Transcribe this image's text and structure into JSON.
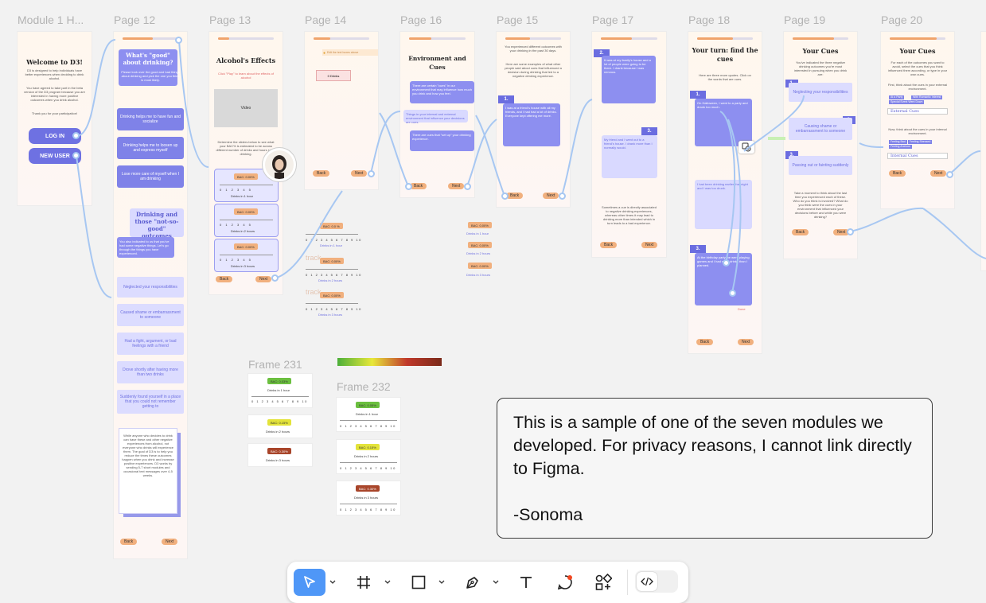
{
  "labels": {
    "module": "Module 1 H...",
    "p12": "Page 12",
    "p13": "Page 13",
    "p14": "Page 14",
    "p16": "Page 16",
    "p15": "Page 15",
    "p17": "Page 17",
    "p18": "Page 18",
    "p19": "Page 19",
    "p20": "Page 20",
    "f231": "Frame 231",
    "f232": "Frame 232"
  },
  "m1": {
    "title": "Welcome to D3!",
    "intro": "D3 is designed to help individuals have better experiences when deciding to drink alcohol.",
    "body": "You have agreed to take part in the beta version of the D3 program because you are interested in having more positive outcomes when you drink alcohol.",
    "thanks": "Thank you for your participation!",
    "login": "LOG IN",
    "newuser": "NEW USER"
  },
  "p12": {
    "q1": "What's \"good\" about drinking?",
    "q1_sub": "Please look over the good and bad things about drinking and pick the one you think is most likely.",
    "opt1": "Drinking helps me to have fun and socialize",
    "opt2": "Drinking helps me to loosen up and express myself",
    "opt3": "Lose more care of myself when I am drinking",
    "q2": "Drinking and those \"not-so-good\" outcomes",
    "q2_sub": "You also indicated to us that you've had some negative things. Let's go through the things you have experienced.",
    "neg1": "Neglected your responsibilities",
    "neg2": "Caused shame or embarrassment to someone",
    "neg3": "Had a fight, argument, or bad feelings with a friend",
    "neg4": "Drove shortly after having more than two drinks",
    "neg5": "Suddenly found yourself in a place that you could not remember getting to",
    "card": "While anyone who decides to drink can have these and other negative experiences from alcohol, not everyone who drinks will experience them. The goal of D3 is to help you reduce the times these outcomes happen when you drink and increase positive experiences. D3 works by sending 5-7 short modules and occasional text messages over 4-5 weeks.",
    "back": "Back",
    "next": "Next"
  },
  "p13": {
    "title": "Alcohol's Effects",
    "sub": "Click \"Play\" to learn about the effects of alcohol",
    "video": "Video",
    "body": "Determine the sliders below to see what your BAC% is estimated to be across different number of drinks and hours spent drinking.",
    "bac": "BAC: 0.00%",
    "scale": "0 1 2 3 4 5",
    "d1": "Drinks in 1 hour",
    "d2": "Drinks in 2 hours",
    "d3": "Drinks in 3 hours",
    "back": "Back",
    "next": "Next"
  },
  "p14": {
    "note": "Edit the text boxes above",
    "box": "0 Drinks",
    "back": "Back",
    "next": "Next",
    "bac1": "BAC: 0.0 %",
    "bac2": "BAC: 0.00%",
    "bac3": "BAC: 0.00%",
    "scale": "0 1 2 3 4 5 6 7 8 9 10",
    "d1": "Drinks in 1 hour",
    "d2": "Drinks in 2 hours",
    "d3": "Drinks in 3 hours",
    "track": "track"
  },
  "p16": {
    "title": "Environment and Cues",
    "b1": "There are certain \"cues\" in our environment that may influence how much you drink and how you feel.",
    "b2": "Things in your internal and external environment that influence your decisions are cues.",
    "b3": "There are cues that \"set up\" your drinking experience.",
    "back": "Back",
    "next": "Next"
  },
  "p15": {
    "intro": "You experienced different outcomes with your drinking in the past 30 days.",
    "intro2": "Here are some examples of what other people said about cues that influenced a decision during drinking that led to a negative drinking experience.",
    "n1": "1.",
    "b1": "I was at a friend's house with all my friends, and I had had a lot of drinks. Everyone kept offering me more.",
    "back": "Back",
    "next": "Next"
  },
  "p17": {
    "n2": "2.",
    "b2": "It was at my family's house and a lot of people were going to be there. I drank because I was nervous.",
    "n3": "3.",
    "b3": "My friend and I went out to a friend's house. I drank more than I normally would.",
    "body": "Sometimes a cue is directly associated to negative drinking experiences, whereas other times it may lead to drinking more than intended which in turn leads to a bad experience.",
    "back": "Back",
    "next": "Next"
  },
  "p18": {
    "title": "Your turn: find the cues",
    "sub": "Here are three more quotes. Click on the words that are cues.",
    "n1": "1.",
    "b1": "On Halloween, I went to a party and drank too much.",
    "b2": "I had been drinking earlier that night and I was too drunk.",
    "n3": "3.",
    "b3": "At the birthday party we were playing games and I had more drinks than I planned.",
    "done": "Done",
    "back": "Back",
    "next": "Next"
  },
  "p19": {
    "title": "Your Cues",
    "sub": "You've indicated the three negative drinking outcomes you're most interested in pursuing when you drink are:",
    "i1": "Neglecting your responsibilities",
    "i2": "Causing shame or embarrassment to someone",
    "i3": "Passing out or fainting suddenly",
    "body": "Take a moment to think about the last time you experienced each of these. Who do you think is involved? What do you think were the cues in your environment that influenced your decisions before and while you were drinking?",
    "n1": "1.",
    "n2": "2.",
    "n3": "3.",
    "back": "Back",
    "next": "Next"
  },
  "p20": {
    "title": "Your Cues",
    "sub": "For each of the outcomes you want to avoid, select the cues that you think influenced them according, or type in your own cues.",
    "sub2": "First, think about the cues in your external environment.",
    "c1": "At a Party",
    "c2": "With Romantic Interest",
    "c3": "Special Event Went Down",
    "ext": "External Cues",
    "sub3": "Now, think about the cues in your internal environment.",
    "c4": "Feeling Bad",
    "c5": "Feeling Stressed",
    "c6": "Feeling Anxious",
    "int": "Internal Cues",
    "back": "Back",
    "next": "Next"
  },
  "f231": {
    "bac1": "BAC: 0.03%",
    "bac2": "BAC: 0.15%",
    "bac3": "BAC: 0.30%",
    "d1": "Drinks in 1 hour",
    "d2": "Drinks in 2 hours",
    "d3": "Drinks in 3 hours",
    "scale": "0 1 2 3 4 5 6 7 8 9 10"
  },
  "f232": {
    "bac1": "BAC: 0.05%",
    "bac2": "BAC: 0.15%",
    "bac3": "BAC: 0.30%",
    "d1": "Drinks in 1 hour",
    "d2": "Drinks in 2 hours",
    "d3": "Drinks in 3 hours",
    "scale": "0 1 2 3 4 5 6 7 8 9 10"
  },
  "note": {
    "text": "This is a sample of one of the seven modules we developed. For privacy reasons, I cannot link directly to Figma.\n\n-Sonoma"
  },
  "toolbar": {
    "tools": [
      "move-tool",
      "frame-tool",
      "shape-tool",
      "pen-tool",
      "text-tool",
      "comment-tool",
      "resources-tool",
      "dev-mode-toggle"
    ]
  },
  "colors": {
    "accent": "#4f97f7",
    "purple": "#6e71e2",
    "orange": "#f1b07e",
    "connector": "#a7c7f2"
  }
}
